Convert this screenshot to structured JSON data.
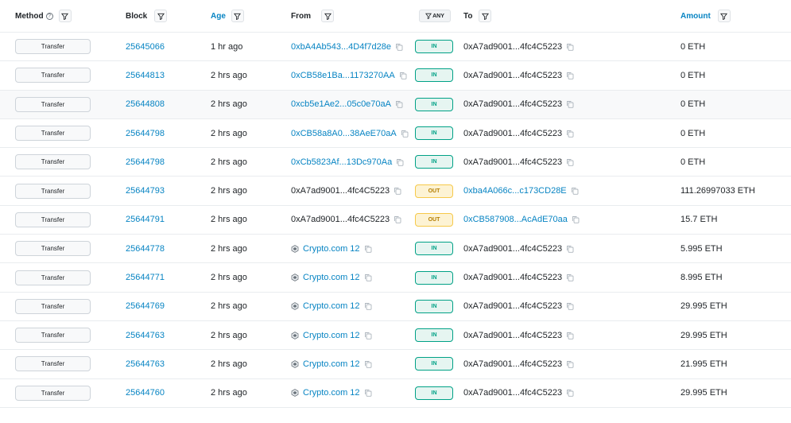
{
  "header": {
    "method": "Method",
    "info_glyph": "?",
    "block": "Block",
    "age": "Age",
    "from": "From",
    "any": "ANY",
    "to": "To",
    "amount": "Amount"
  },
  "icons": {
    "filter": "filter-icon",
    "info": "info-icon",
    "copy": "copy-icon",
    "entity": "crypto-com-logo-icon"
  },
  "colors": {
    "link": "#0784c3",
    "in_badge": "#00a186",
    "out_badge": "#f6c94a"
  },
  "rows": [
    {
      "method": "Transfer",
      "block": "25645066",
      "age": "1 hr ago",
      "from": "0xbA4Ab543...4D4f7d28e",
      "from_link": true,
      "from_entity": false,
      "direction": "IN",
      "to": "0xA7ad9001...4fc4C5223",
      "to_link": false,
      "amount": "0 ETH"
    },
    {
      "method": "Transfer",
      "block": "25644813",
      "age": "2 hrs ago",
      "from": "0xCB58e1Ba...1173270AA",
      "from_link": true,
      "from_entity": false,
      "direction": "IN",
      "to": "0xA7ad9001...4fc4C5223",
      "to_link": false,
      "amount": "0 ETH"
    },
    {
      "method": "Transfer",
      "block": "25644808",
      "age": "2 hrs ago",
      "from": "0xcb5e1Ae2...05c0e70aA",
      "from_link": true,
      "from_entity": false,
      "direction": "IN",
      "to": "0xA7ad9001...4fc4C5223",
      "to_link": false,
      "amount": "0 ETH"
    },
    {
      "method": "Transfer",
      "block": "25644798",
      "age": "2 hrs ago",
      "from": "0xCB58a8A0...38AeE70aA",
      "from_link": true,
      "from_entity": false,
      "direction": "IN",
      "to": "0xA7ad9001...4fc4C5223",
      "to_link": false,
      "amount": "0 ETH"
    },
    {
      "method": "Transfer",
      "block": "25644798",
      "age": "2 hrs ago",
      "from": "0xCb5823Af...13Dc970Aa",
      "from_link": true,
      "from_entity": false,
      "direction": "IN",
      "to": "0xA7ad9001...4fc4C5223",
      "to_link": false,
      "amount": "0 ETH"
    },
    {
      "method": "Transfer",
      "block": "25644793",
      "age": "2 hrs ago",
      "from": "0xA7ad9001...4fc4C5223",
      "from_link": false,
      "from_entity": false,
      "direction": "OUT",
      "to": "0xba4A066c...c173CD28E",
      "to_link": true,
      "amount": "111.26997033 ETH"
    },
    {
      "method": "Transfer",
      "block": "25644791",
      "age": "2 hrs ago",
      "from": "0xA7ad9001...4fc4C5223",
      "from_link": false,
      "from_entity": false,
      "direction": "OUT",
      "to": "0xCB587908...AcAdE70aa",
      "to_link": true,
      "amount": "15.7 ETH"
    },
    {
      "method": "Transfer",
      "block": "25644778",
      "age": "2 hrs ago",
      "from": "Crypto.com 12",
      "from_link": true,
      "from_entity": true,
      "direction": "IN",
      "to": "0xA7ad9001...4fc4C5223",
      "to_link": false,
      "amount": "5.995 ETH"
    },
    {
      "method": "Transfer",
      "block": "25644771",
      "age": "2 hrs ago",
      "from": "Crypto.com 12",
      "from_link": true,
      "from_entity": true,
      "direction": "IN",
      "to": "0xA7ad9001...4fc4C5223",
      "to_link": false,
      "amount": "8.995 ETH"
    },
    {
      "method": "Transfer",
      "block": "25644769",
      "age": "2 hrs ago",
      "from": "Crypto.com 12",
      "from_link": true,
      "from_entity": true,
      "direction": "IN",
      "to": "0xA7ad9001...4fc4C5223",
      "to_link": false,
      "amount": "29.995 ETH"
    },
    {
      "method": "Transfer",
      "block": "25644763",
      "age": "2 hrs ago",
      "from": "Crypto.com 12",
      "from_link": true,
      "from_entity": true,
      "direction": "IN",
      "to": "0xA7ad9001...4fc4C5223",
      "to_link": false,
      "amount": "29.995 ETH"
    },
    {
      "method": "Transfer",
      "block": "25644763",
      "age": "2 hrs ago",
      "from": "Crypto.com 12",
      "from_link": true,
      "from_entity": true,
      "direction": "IN",
      "to": "0xA7ad9001...4fc4C5223",
      "to_link": false,
      "amount": "21.995 ETH"
    },
    {
      "method": "Transfer",
      "block": "25644760",
      "age": "2 hrs ago",
      "from": "Crypto.com 12",
      "from_link": true,
      "from_entity": true,
      "direction": "IN",
      "to": "0xA7ad9001...4fc4C5223",
      "to_link": false,
      "amount": "29.995 ETH"
    }
  ]
}
